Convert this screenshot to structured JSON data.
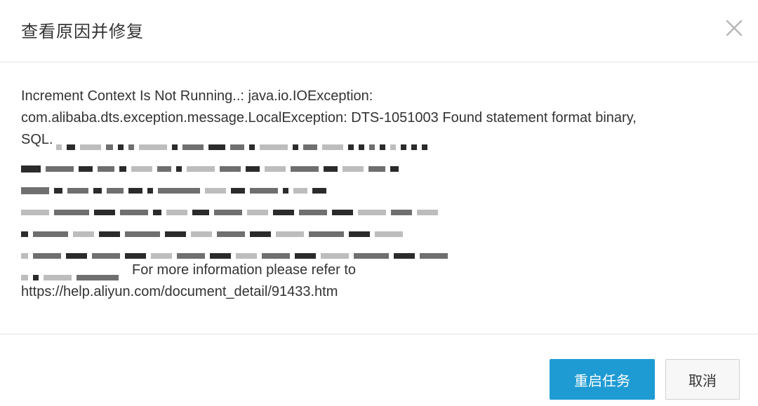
{
  "dialog": {
    "title": "查看原因并修复",
    "close_icon": "close-icon"
  },
  "message": {
    "line1": "Increment Context Is Not Running..: java.io.IOException:",
    "line2": "com.alibaba.dts.exception.message.LocalException: DTS-1051003 Found statement format binary,",
    "line3_prefix": "SQL.",
    "line9_suffix": "For more information please refer to",
    "line10": "https://help.aliyun.com/document_detail/91433.htm"
  },
  "footer": {
    "primary_label": "重启任务",
    "cancel_label": "取消"
  },
  "colors": {
    "primary": "#1f9bd4",
    "text": "#333333",
    "divider": "#e4e4e4"
  }
}
